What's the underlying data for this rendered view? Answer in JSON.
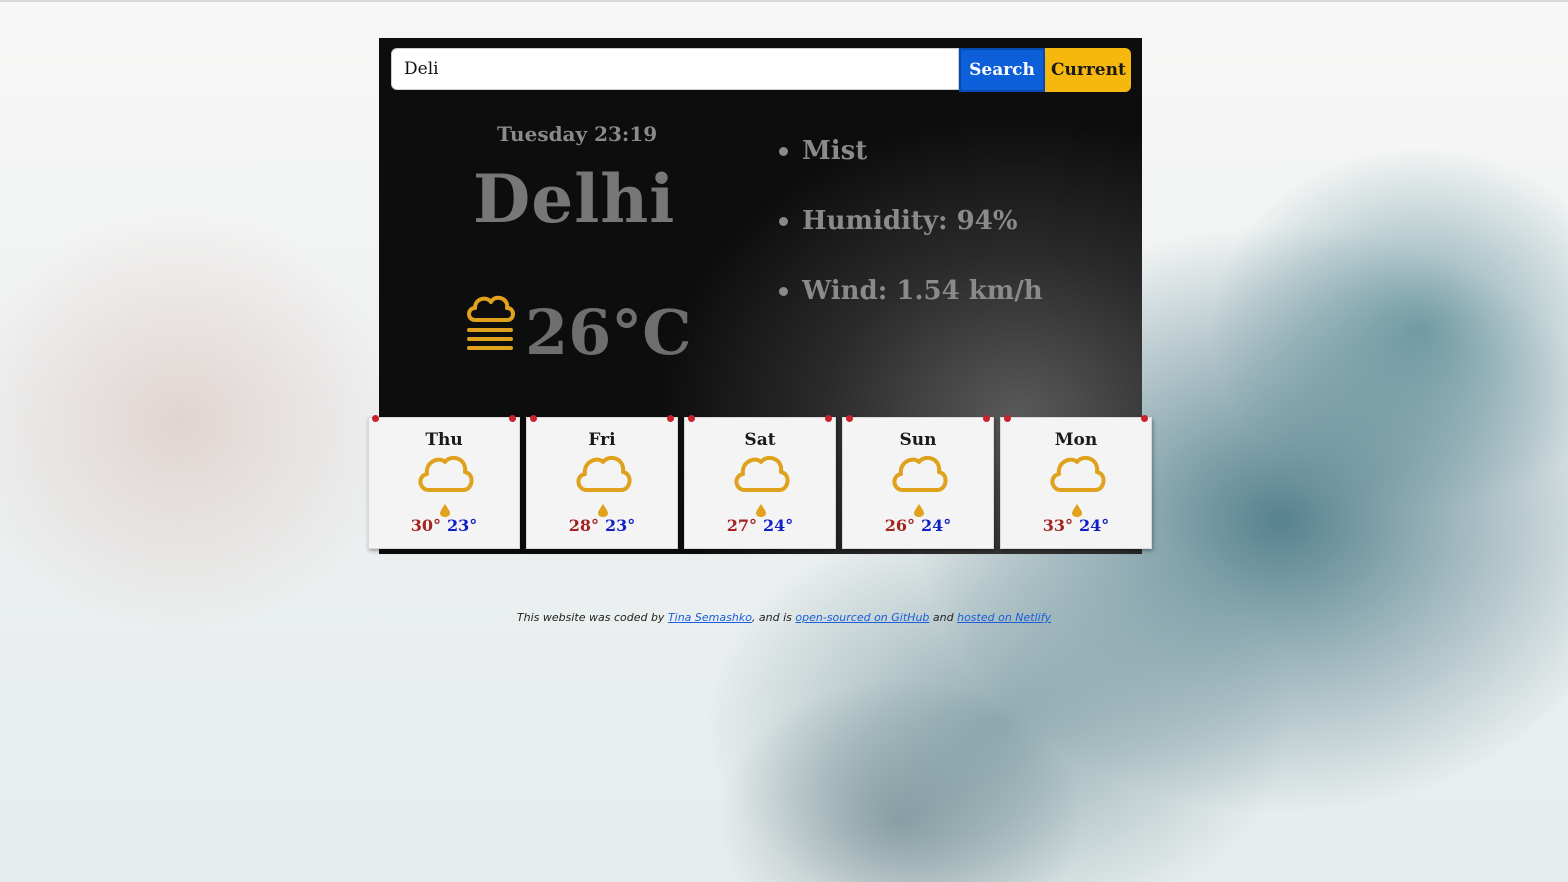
{
  "search": {
    "value": "Deli",
    "button_label": "Search",
    "current_label": "Current"
  },
  "current": {
    "datetime": "Tuesday 23:19",
    "city": "Delhi",
    "temperature": "26",
    "unit": "°C",
    "icon": "mist-icon",
    "description": "Mist",
    "humidity": "Humidity: 94%",
    "wind": "Wind: 1.54 km/h"
  },
  "forecast": [
    {
      "day": "Thu",
      "icon": "cloud-icon",
      "hi": "30°",
      "lo": "23°"
    },
    {
      "day": "Fri",
      "icon": "cloud-icon",
      "hi": "28°",
      "lo": "23°"
    },
    {
      "day": "Sat",
      "icon": "cloud-icon",
      "hi": "27°",
      "lo": "24°"
    },
    {
      "day": "Sun",
      "icon": "cloud-icon",
      "hi": "26°",
      "lo": "24°"
    },
    {
      "day": "Mon",
      "icon": "cloud-icon",
      "hi": "33°",
      "lo": "24°"
    }
  ],
  "footer": {
    "prefix": "This website was coded by ",
    "author_link": "Tina Semashko",
    "middle": ", and is ",
    "github_link": "open-sourced on GitHub",
    "and": " and ",
    "netlify_link": "hosted on Netlify"
  },
  "colors": {
    "search_button": "#0d5fd9",
    "current_button": "#f6b70f",
    "icon": "#e0a21c",
    "high_temp": "#a32222",
    "low_temp": "#1020c8"
  }
}
